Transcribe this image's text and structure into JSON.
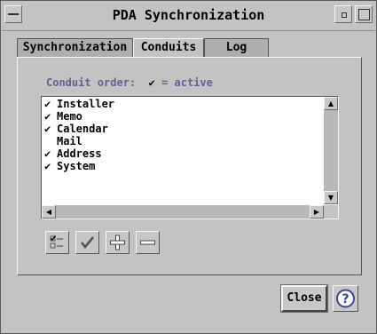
{
  "window": {
    "title": "PDA Synchronization",
    "controls": [
      "window-menu-icon",
      "minimize-icon",
      "maximize-icon"
    ]
  },
  "tabs": [
    {
      "label": "Synchronization",
      "active": false
    },
    {
      "label": "Conduits",
      "active": true
    },
    {
      "label": "Log",
      "active": false
    }
  ],
  "conduits": {
    "order_label": "Conduit order:",
    "legend_mark": "✔",
    "legend_text": "= active",
    "items": [
      {
        "name": "Installer",
        "active": true
      },
      {
        "name": "Memo",
        "active": true
      },
      {
        "name": "Calendar",
        "active": true
      },
      {
        "name": "Mail",
        "active": false
      },
      {
        "name": "Address",
        "active": true
      },
      {
        "name": "System",
        "active": true
      }
    ],
    "tools": [
      "select-all-icon",
      "activate-check-icon",
      "add-plus-icon",
      "remove-minus-icon"
    ]
  },
  "footer": {
    "close_label": "Close",
    "help_icon": "help-question-icon"
  },
  "colors": {
    "background": "#c3c3c3",
    "label_blue": "#5d6490",
    "list_bg": "#ffffff"
  }
}
